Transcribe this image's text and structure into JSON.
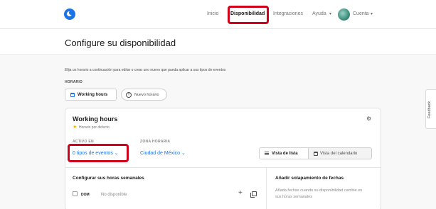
{
  "topbar": {
    "nav": {
      "inicio": "Inicio",
      "disponibilidad": "Disponibilidad",
      "integraciones": "Integraciones",
      "ayuda": "Ayuda",
      "cuenta": "Cuenta"
    },
    "chevron": "▾",
    "accent_color": "#1a73e8",
    "highlight_color": "#d0021b"
  },
  "page": {
    "title": "Configure su disponibilidad",
    "intro": "Elija un horario a continuación para editar o crear uno nuevo que pueda aplicar a sus tipos de eventos",
    "horario_label": "HORARIO",
    "schedule_button": "Working hours",
    "new_schedule_button": "Nuevo horario",
    "plus": "+"
  },
  "card": {
    "title": "Working hours",
    "subtitle": "Horario por defecto",
    "star_icon": "★",
    "gear_icon": "⚙",
    "activo_label": "ACTIVO EN",
    "event_types_dropdown": "0 tipos de eventos",
    "zona_label": "ZONA HORARIA",
    "timezone_dropdown": "Ciudad de México",
    "chevron": "⌄",
    "list_view": "Vista de lista",
    "calendar_view": "Vista del calendario",
    "weekly_title": "Configurar sus horas semanales",
    "day": "DOM",
    "unavailable": "No disponible",
    "add_icon": "+",
    "overrides_title": "Añadir solapamiento de fechas",
    "overrides_desc": "Añada fechas cuando su disponibilidad cambie en sus horas semanales"
  },
  "feedback": "Feedback"
}
